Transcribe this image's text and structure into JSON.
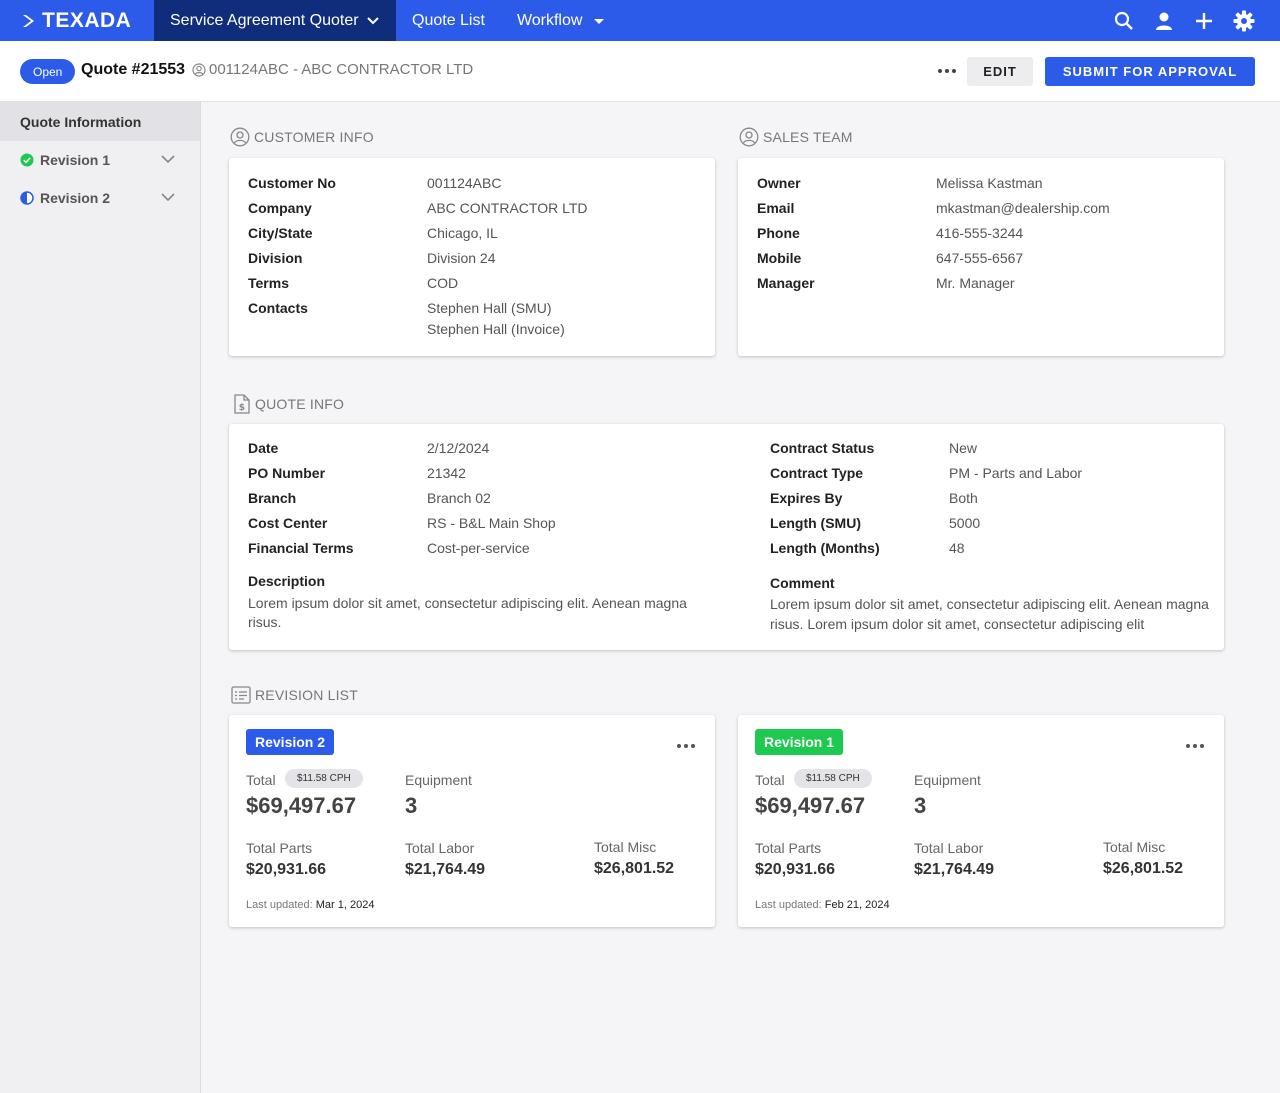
{
  "nav": {
    "brand": "TEXADA",
    "items": [
      {
        "label": "Service Agreement Quoter",
        "active": true
      },
      {
        "label": "Quote List"
      },
      {
        "label": "Workflow"
      }
    ],
    "icons": [
      "search-icon",
      "user-icon",
      "plus-icon",
      "gear-icon"
    ]
  },
  "header": {
    "status": "Open",
    "title": "Quote #21553",
    "customer": "001124ABC - ABC CONTRACTOR LTD",
    "edit_label": "EDIT",
    "submit_label": "SUBMIT FOR APPROVAL"
  },
  "sidebar": {
    "heading": "Quote Information",
    "items": [
      {
        "label": "Revision 1",
        "status": "complete"
      },
      {
        "label": "Revision 2",
        "status": "in-progress"
      }
    ]
  },
  "customer_info": {
    "title": "CUSTOMER INFO",
    "fields": [
      {
        "label": "Customer No",
        "value": "001124ABC"
      },
      {
        "label": "Company",
        "value": "ABC CONTRACTOR LTD"
      },
      {
        "label": "City/State",
        "value": "Chicago, IL"
      },
      {
        "label": "Division",
        "value": "Division 24"
      },
      {
        "label": "Terms",
        "value": "COD"
      },
      {
        "label": "Contacts",
        "value": "Stephen Hall (SMU)",
        "value2": "Stephen Hall (Invoice)"
      }
    ]
  },
  "sales_team": {
    "title": "SALES TEAM",
    "fields": [
      {
        "label": "Owner",
        "value": "Melissa Kastman"
      },
      {
        "label": "Email",
        "value": "mkastman@dealership.com"
      },
      {
        "label": "Phone",
        "value": "416-555-3244"
      },
      {
        "label": "Mobile",
        "value": "647-555-6567"
      },
      {
        "label": "Manager",
        "value": "Mr. Manager"
      }
    ]
  },
  "quote_info": {
    "title": "QUOTE INFO",
    "left": [
      {
        "label": "Date",
        "value": "2/12/2024"
      },
      {
        "label": "PO Number",
        "value": "21342"
      },
      {
        "label": "Branch",
        "value": "Branch 02"
      },
      {
        "label": "Cost Center",
        "value": "RS - B&L Main Shop"
      },
      {
        "label": "Financial Terms",
        "value": "Cost-per-service"
      }
    ],
    "right": [
      {
        "label": "Contract Status",
        "value": "New"
      },
      {
        "label": "Contract Type",
        "value": "PM - Parts and Labor"
      },
      {
        "label": "Expires By",
        "value": "Both"
      },
      {
        "label": "Length (SMU)",
        "value": "5000"
      },
      {
        "label": "Length (Months)",
        "value": "48"
      }
    ],
    "description_label": "Description",
    "description_line1": "Lorem ipsum dolor sit amet, consectetur adipiscing elit. Aenean magna",
    "description_line2": "risus.",
    "comment_label": "Comment",
    "comment_line1": "Lorem ipsum dolor sit amet, consectetur adipiscing elit. Aenean magna",
    "comment_line2": "risus. Lorem ipsum dolor sit amet, consectetur adipiscing elit"
  },
  "revision_list": {
    "title": "REVISION LIST",
    "revisions": [
      {
        "label": "Revision 2",
        "color": "#2c5bea",
        "total_label": "Total",
        "cph": "$11.58 CPH",
        "total": "$69,497.67",
        "equipment_label": "Equipment",
        "equipment": "3",
        "parts_label": "Total Parts",
        "parts": "$20,931.66",
        "labor_label": "Total Labor",
        "labor": "$21,764.49",
        "misc_label": "Total Misc",
        "misc": "$26,801.52",
        "updated_label": "Last updated:",
        "updated": "Mar 1, 2024"
      },
      {
        "label": "Revision 1",
        "color": "#1dc94f",
        "total_label": "Total",
        "cph": "$11.58 CPH",
        "total": "$69,497.67",
        "equipment_label": "Equipment",
        "equipment": "3",
        "parts_label": "Total Parts",
        "parts": "$20,931.66",
        "labor_label": "Total Labor",
        "labor": "$21,764.49",
        "misc_label": "Total Misc",
        "misc": "$26,801.52",
        "updated_label": "Last updated:",
        "updated": "Feb 21, 2024"
      }
    ]
  },
  "colors": {
    "primary": "#2c5bea",
    "nav_active": "#0f2d7a",
    "success": "#1dc94f"
  }
}
